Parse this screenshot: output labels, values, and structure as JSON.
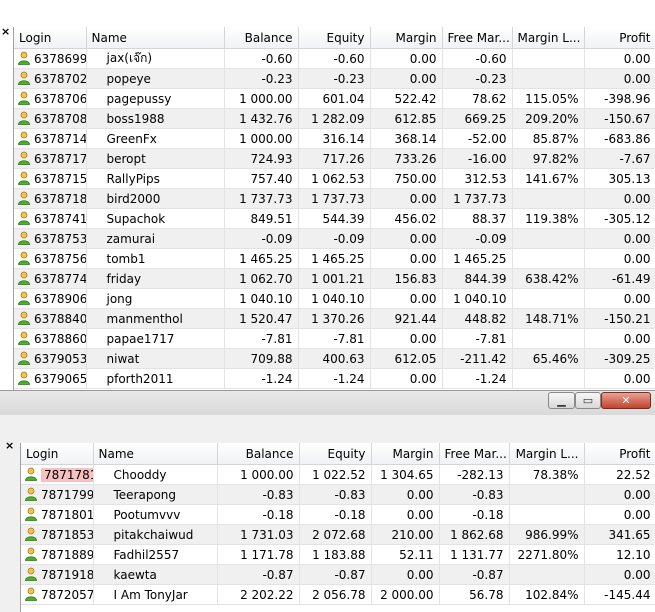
{
  "columns": {
    "login": "Login",
    "name": "Name",
    "balance": "Balance",
    "equity": "Equity",
    "margin": "Margin",
    "free_margin": "Free Mar...",
    "margin_level": "Margin L...",
    "profit": "Profit"
  },
  "top_panel": {
    "close_glyph": "×",
    "rows": [
      {
        "login": "6378699",
        "name": "jax(เจ๊ก)",
        "balance": "-0.60",
        "equity": "-0.60",
        "margin": "0.00",
        "free_margin": "-0.60",
        "margin_level": "",
        "profit": "0.00"
      },
      {
        "login": "6378702",
        "name": "popeye",
        "balance": "-0.23",
        "equity": "-0.23",
        "margin": "0.00",
        "free_margin": "-0.23",
        "margin_level": "",
        "profit": "0.00"
      },
      {
        "login": "6378706",
        "name": "pagepussy",
        "balance": "1 000.00",
        "equity": "601.04",
        "margin": "522.42",
        "free_margin": "78.62",
        "margin_level": "115.05%",
        "profit": "-398.96"
      },
      {
        "login": "6378708",
        "name": "boss1988",
        "balance": "1 432.76",
        "equity": "1 282.09",
        "margin": "612.85",
        "free_margin": "669.25",
        "margin_level": "209.20%",
        "profit": "-150.67"
      },
      {
        "login": "6378714",
        "name": "GreenFx",
        "balance": "1 000.00",
        "equity": "316.14",
        "margin": "368.14",
        "free_margin": "-52.00",
        "margin_level": "85.87%",
        "profit": "-683.86"
      },
      {
        "login": "6378717",
        "name": "beropt",
        "balance": "724.93",
        "equity": "717.26",
        "margin": "733.26",
        "free_margin": "-16.00",
        "margin_level": "97.82%",
        "profit": "-7.67"
      },
      {
        "login": "6378715",
        "name": "RallyPips",
        "balance": "757.40",
        "equity": "1 062.53",
        "margin": "750.00",
        "free_margin": "312.53",
        "margin_level": "141.67%",
        "profit": "305.13"
      },
      {
        "login": "6378718",
        "name": "bird2000",
        "balance": "1 737.73",
        "equity": "1 737.73",
        "margin": "0.00",
        "free_margin": "1 737.73",
        "margin_level": "",
        "profit": "0.00"
      },
      {
        "login": "6378741",
        "name": "Supachok",
        "balance": "849.51",
        "equity": "544.39",
        "margin": "456.02",
        "free_margin": "88.37",
        "margin_level": "119.38%",
        "profit": "-305.12"
      },
      {
        "login": "6378753",
        "name": "zamurai",
        "balance": "-0.09",
        "equity": "-0.09",
        "margin": "0.00",
        "free_margin": "-0.09",
        "margin_level": "",
        "profit": "0.00"
      },
      {
        "login": "6378756",
        "name": "tomb1",
        "balance": "1 465.25",
        "equity": "1 465.25",
        "margin": "0.00",
        "free_margin": "1 465.25",
        "margin_level": "",
        "profit": "0.00"
      },
      {
        "login": "6378774",
        "name": "friday",
        "balance": "1 062.70",
        "equity": "1 001.21",
        "margin": "156.83",
        "free_margin": "844.39",
        "margin_level": "638.42%",
        "profit": "-61.49"
      },
      {
        "login": "6378906",
        "name": "jong",
        "balance": "1 040.10",
        "equity": "1 040.10",
        "margin": "0.00",
        "free_margin": "1 040.10",
        "margin_level": "",
        "profit": "0.00"
      },
      {
        "login": "6378840",
        "name": "manmenthol",
        "balance": "1 520.47",
        "equity": "1 370.26",
        "margin": "921.44",
        "free_margin": "448.82",
        "margin_level": "148.71%",
        "profit": "-150.21"
      },
      {
        "login": "6378860",
        "name": "papae1717",
        "balance": "-7.81",
        "equity": "-7.81",
        "margin": "0.00",
        "free_margin": "-7.81",
        "margin_level": "",
        "profit": "0.00"
      },
      {
        "login": "6379053",
        "name": "niwat",
        "balance": "709.88",
        "equity": "400.63",
        "margin": "612.05",
        "free_margin": "-211.42",
        "margin_level": "65.46%",
        "profit": "-309.25"
      },
      {
        "login": "6379065",
        "name": "pforth2011",
        "balance": "-1.24",
        "equity": "-1.24",
        "margin": "0.00",
        "free_margin": "-1.24",
        "margin_level": "",
        "profit": "0.00"
      }
    ]
  },
  "bottom_window": {
    "close_glyph": "×",
    "caption_buttons": {
      "minimize": "▁",
      "maximize": "▭",
      "close": "✕"
    },
    "rows": [
      {
        "login": "7871781",
        "name": "Chooddy",
        "balance": "1 000.00",
        "equity": "1 022.52",
        "margin": "1 304.65",
        "free_margin": "-282.13",
        "margin_level": "78.38%",
        "profit": "22.52",
        "selected": true
      },
      {
        "login": "7871799",
        "name": "Teerapong",
        "balance": "-0.83",
        "equity": "-0.83",
        "margin": "0.00",
        "free_margin": "-0.83",
        "margin_level": "",
        "profit": "0.00"
      },
      {
        "login": "7871801",
        "name": "Pootumvvv",
        "balance": "-0.18",
        "equity": "-0.18",
        "margin": "0.00",
        "free_margin": "-0.18",
        "margin_level": "",
        "profit": "0.00"
      },
      {
        "login": "7871853",
        "name": "pitakchaiwud",
        "balance": "1 731.03",
        "equity": "2 072.68",
        "margin": "210.00",
        "free_margin": "1 862.68",
        "margin_level": "986.99%",
        "profit": "341.65"
      },
      {
        "login": "7871889",
        "name": "Fadhil2557",
        "balance": "1 171.78",
        "equity": "1 183.88",
        "margin": "52.11",
        "free_margin": "1 131.77",
        "margin_level": "2271.80%",
        "profit": "12.10"
      },
      {
        "login": "7871918",
        "name": "kaewta",
        "balance": "-0.87",
        "equity": "-0.87",
        "margin": "0.00",
        "free_margin": "-0.87",
        "margin_level": "",
        "profit": "0.00"
      },
      {
        "login": "7872057",
        "name": "I Am TonyJar",
        "balance": "2 202.22",
        "equity": "2 056.78",
        "margin": "2 000.00",
        "free_margin": "56.78",
        "margin_level": "102.84%",
        "profit": "-145.44"
      }
    ]
  },
  "colors": {
    "row_alt": "#f0f0f0",
    "selected_login": "#f7c1c1",
    "close_button": "#c4432c"
  },
  "icons": {
    "user": "user-green-icon"
  }
}
